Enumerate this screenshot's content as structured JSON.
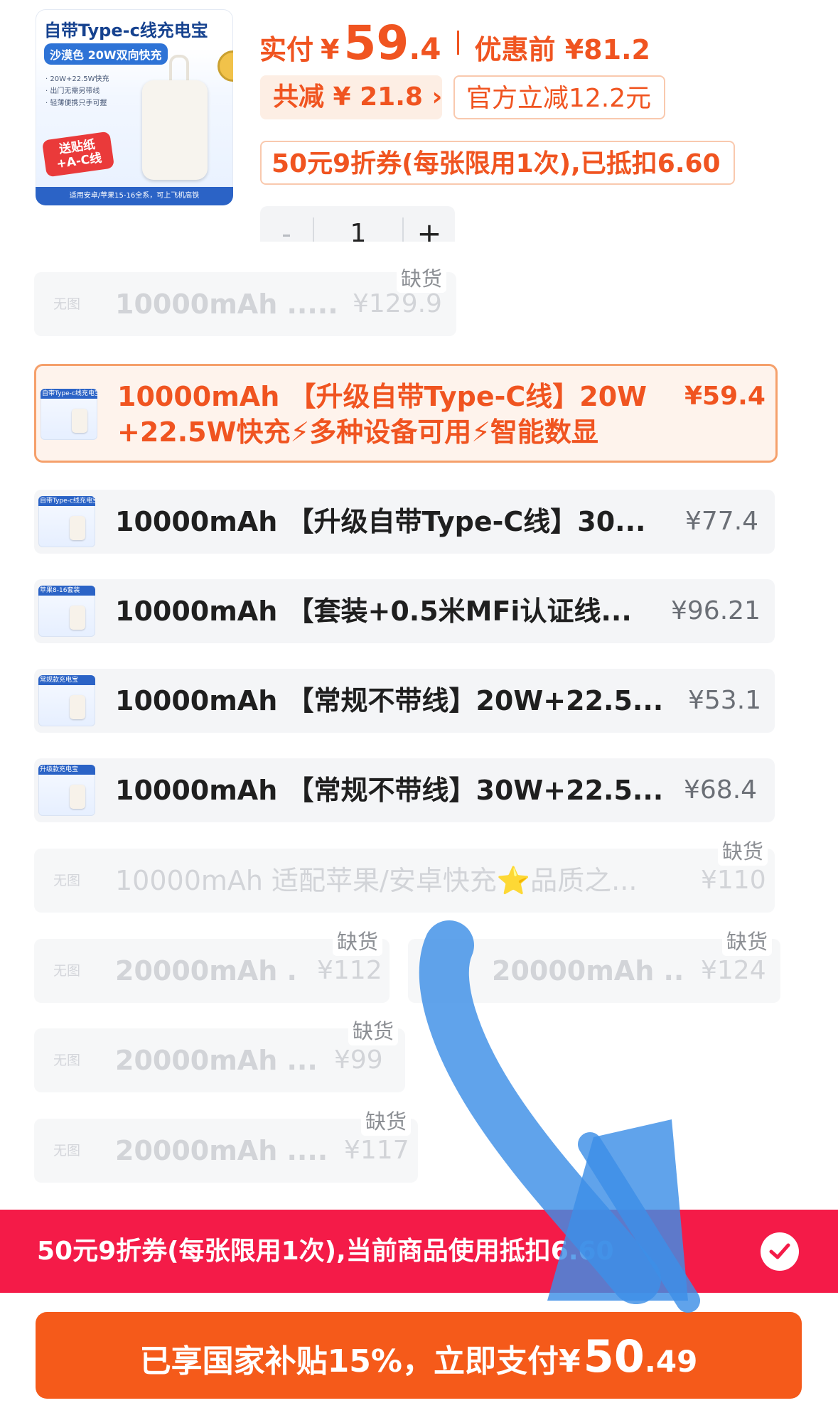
{
  "product": {
    "image": {
      "title": "自带Type-c线充电宝",
      "subtitle": "沙漠色 20W双向快充",
      "features": "· 20W+22.5W快充\n· 出门无需另带线\n· 轻薄便携只手可握",
      "gift": "送贴纸+A-C线",
      "footer": "适用安卓/苹果15-16全系，可上飞机高铁"
    }
  },
  "price": {
    "paid_label": "实付",
    "currency": "¥",
    "paid_int": "59",
    "paid_dec": ".4",
    "original_label": "优惠前 ¥81.2"
  },
  "discounts": {
    "total": "共减 ¥ 21.8 ›",
    "official": "官方立减12.2元",
    "coupon": "50元9折券(每张限用1次),已抵扣6.60"
  },
  "quantity": {
    "minus": "-",
    "value": "1",
    "plus": "+"
  },
  "skus": [
    {
      "name": "10000mAh .....",
      "price": "¥129.9",
      "thumb": "无图",
      "badge": "缺货"
    },
    {
      "name": "10000mAh 【升级自带Type-C线】20W +22.5W快充⚡多种设备可用⚡智能数显",
      "price": "¥59.4",
      "thumb_caption": "自带Type-c线充电宝",
      "selected": true
    },
    {
      "name": "10000mAh 【升级自带Type-C线】30...",
      "price": "¥77.4",
      "thumb_caption": "自带Type-c线充电宝"
    },
    {
      "name": "10000mAh 【套装+0.5米MFi认证线...",
      "price": "¥96.21",
      "thumb_caption": "苹果8-16套装"
    },
    {
      "name": "10000mAh 【常规不带线】20W+22.5...",
      "price": "¥53.1",
      "thumb_caption": "常规款充电宝"
    },
    {
      "name": "10000mAh 【常规不带线】30W+22.5...",
      "price": "¥68.4",
      "thumb_caption": "升级款充电宝"
    },
    {
      "name": "10000mAh 适配苹果/安卓快充⭐品质之...",
      "price": "¥110",
      "thumb": "无图",
      "badge": "缺货"
    },
    {
      "name": "20000mAh .",
      "price": "¥112",
      "thumb": "无图",
      "badge": "缺货"
    },
    {
      "name": "20000mAh ..",
      "price": "¥124",
      "badge": "缺货"
    },
    {
      "name": "20000mAh ...",
      "price": "¥99",
      "thumb": "无图",
      "badge": "缺货"
    },
    {
      "name": "20000mAh ....",
      "price": "¥117",
      "thumb": "无图",
      "badge": "缺货"
    }
  ],
  "coupon_bar": {
    "text": "50元9折券(每张限用1次),当前商品使用抵扣6.60",
    "checked": true
  },
  "pay_button": {
    "label": "已享国家补贴15%，立即支付",
    "currency": "¥",
    "amount_int": "50",
    "amount_dec": ".49"
  },
  "colors": {
    "accent": "#f05420",
    "coupon_bar": "#f41b48",
    "pay_button": "#f55a1a",
    "annotation_arrow": "#3d8fe6"
  },
  "icons": [
    "check-icon",
    "chevron-right-icon",
    "lightning-icon"
  ]
}
